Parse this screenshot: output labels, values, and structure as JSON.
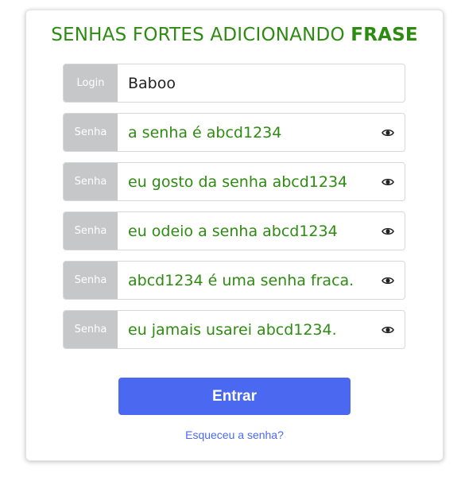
{
  "title": {
    "prefix": "SENHAS FORTES ADICIONANDO ",
    "emphasis": "FRASE"
  },
  "colors": {
    "accent_green": "#2e8b12",
    "button_blue": "#4a69f0",
    "label_gray": "#c6c7c9"
  },
  "login": {
    "label": "Login",
    "value": "Baboo"
  },
  "passwords": [
    {
      "label": "Senha",
      "value": "a senha é abcd1234",
      "icon": "eye-icon"
    },
    {
      "label": "Senha",
      "value": "eu gosto da senha abcd1234",
      "icon": "eye-icon"
    },
    {
      "label": "Senha",
      "value": "eu odeio a senha abcd1234",
      "icon": "eye-icon"
    },
    {
      "label": "Senha",
      "value": "abcd1234 é uma senha fraca.",
      "icon": "eye-icon"
    },
    {
      "label": "Senha",
      "value": "eu jamais usarei abcd1234.",
      "icon": "eye-icon"
    }
  ],
  "submit_label": "Entrar",
  "forgot_label": "Esqueceu a senha?"
}
